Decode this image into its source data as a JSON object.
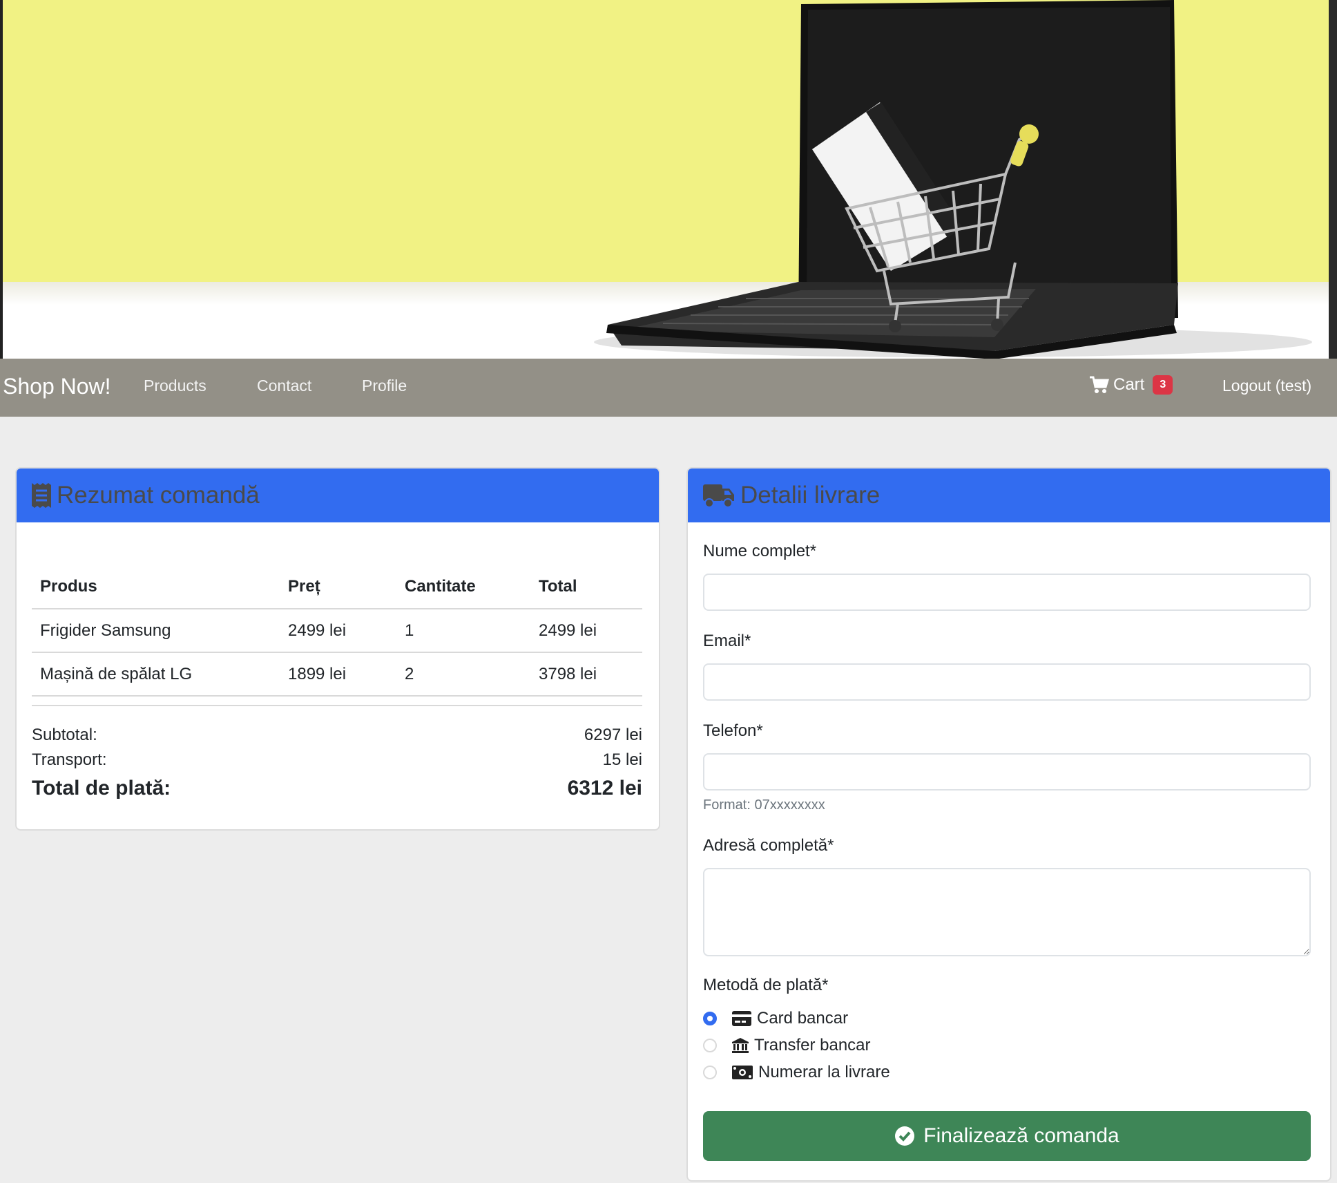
{
  "navbar": {
    "brand": "Shop Now!",
    "links": [
      "Products",
      "Contact",
      "Profile"
    ],
    "cart_label": "Cart",
    "cart_count": "3",
    "logout": "Logout (test)"
  },
  "summary": {
    "title": "Rezumat comandă",
    "columns": [
      "Produs",
      "Preț",
      "Cantitate",
      "Total"
    ],
    "rows": [
      [
        "Frigider Samsung",
        "2499 lei",
        "1",
        "2499 lei"
      ],
      [
        "Mașină de spălat LG",
        "1899 lei",
        "2",
        "3798 lei"
      ]
    ],
    "subtotal_label": "Subtotal:",
    "subtotal_value": "6297 lei",
    "transport_label": "Transport:",
    "transport_value": "15 lei",
    "total_label": "Total de plată:",
    "total_value": "6312 lei"
  },
  "delivery": {
    "title": "Detalii livrare",
    "name_label": "Nume complet*",
    "name_value": "",
    "email_label": "Email*",
    "email_value": "",
    "phone_label": "Telefon*",
    "phone_value": "",
    "phone_help": "Format: 07xxxxxxxx",
    "address_label": "Adresă completă*",
    "address_value": "",
    "payment_label": "Metodă de plată*",
    "payment_options": [
      "Card bancar",
      "Transfer bancar",
      "Numerar la livrare"
    ],
    "payment_selected": "Card bancar",
    "submit_label": "Finalizează comanda"
  },
  "colors": {
    "primary": "#326cf0",
    "success": "#3e8657",
    "navbar": "#939087",
    "badge": "#dc3545",
    "hero_background": "#f1f284"
  }
}
